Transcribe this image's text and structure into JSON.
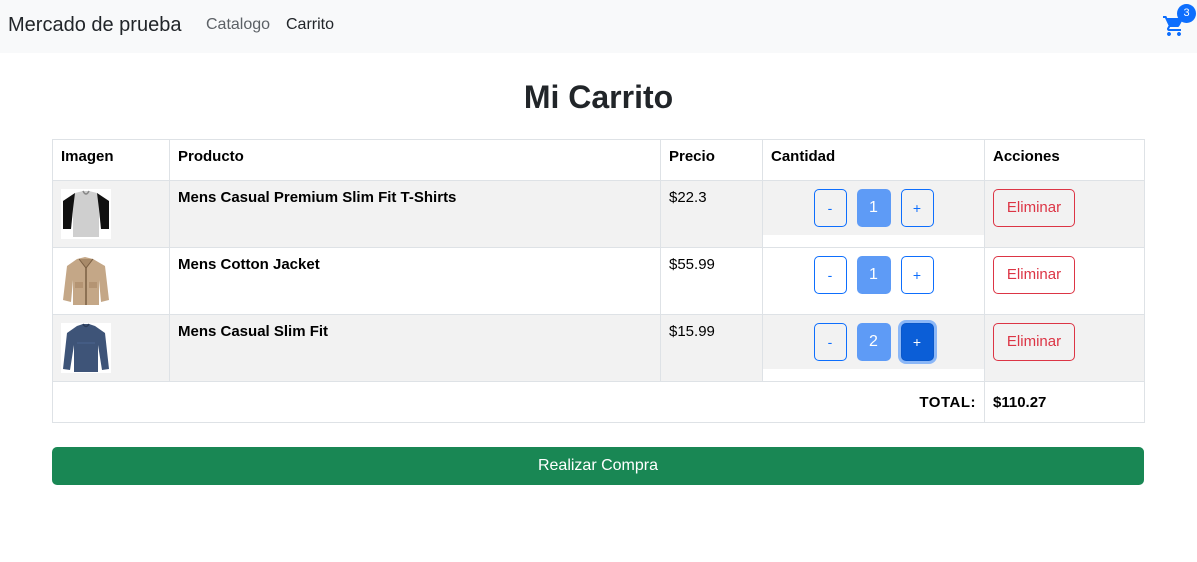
{
  "navbar": {
    "brand": "Mercado de prueba",
    "links": [
      "Catalogo",
      "Carrito"
    ],
    "cart_icon": "shopping-cart-icon",
    "cart_count": "3"
  },
  "page": {
    "title": "Mi Carrito"
  },
  "table": {
    "headers": [
      "Imagen",
      "Producto",
      "Precio",
      "Cantidad",
      "Acciones"
    ],
    "rows": [
      {
        "image_icon": "tshirt-image",
        "product": "Mens Casual Premium Slim Fit T-Shirts",
        "price": "$22.3",
        "qty": "1",
        "minus": "-",
        "plus": "+",
        "action": "Eliminar"
      },
      {
        "image_icon": "jacket-image",
        "product": "Mens Cotton Jacket",
        "price": "$55.99",
        "qty": "1",
        "minus": "-",
        "plus": "+",
        "action": "Eliminar"
      },
      {
        "image_icon": "longsleeve-image",
        "product": "Mens Casual Slim Fit",
        "price": "$15.99",
        "qty": "2",
        "minus": "-",
        "plus": "+",
        "action": "Eliminar"
      }
    ],
    "total_label": "TOTAL:",
    "total_value": "$110.27"
  },
  "checkout_label": "Realizar Compra",
  "colors": {
    "primary": "#0d6efd",
    "danger": "#dc3545",
    "success": "#198754",
    "navbar_bg": "#f8f9fa",
    "stripe": "#f2f2f2"
  }
}
